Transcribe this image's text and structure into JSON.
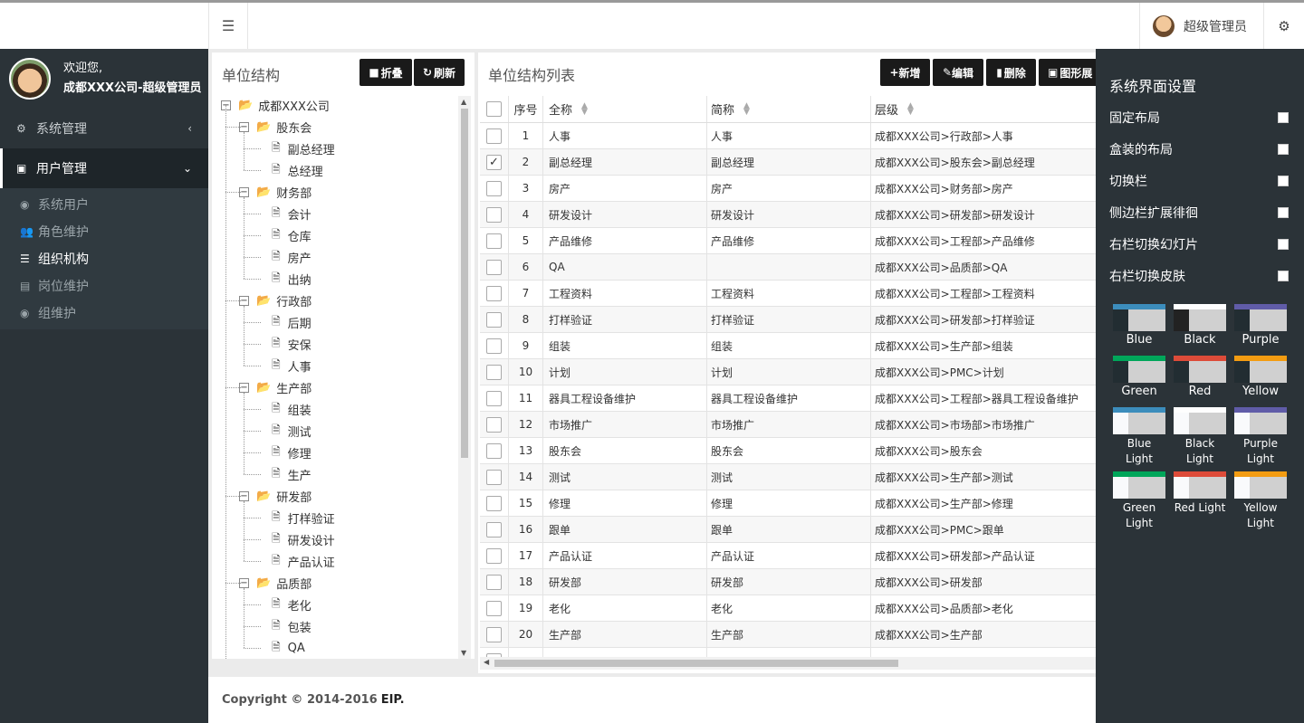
{
  "header": {
    "user_name": "超级管理员"
  },
  "sidebar": {
    "welcome": "欢迎您,",
    "company_user": "成都XXX公司-超级管理员",
    "menu": [
      {
        "label": "系统管理",
        "icon": "gear-icon"
      },
      {
        "label": "用户管理",
        "icon": "id-card-icon"
      }
    ],
    "submenu": [
      {
        "label": "系统用户",
        "icon": "user-circle-icon"
      },
      {
        "label": "角色维护",
        "icon": "users-icon"
      },
      {
        "label": "组织机构",
        "icon": "bars-icon"
      },
      {
        "label": "岗位维护",
        "icon": "id-badge-icon"
      },
      {
        "label": "组维护",
        "icon": "user-circle-icon"
      }
    ]
  },
  "tree_panel": {
    "title": "单位结构",
    "btn_collapse": "折叠",
    "btn_refresh": "刷新",
    "nodes": [
      {
        "label": "成都XXX公司",
        "level": 0,
        "type": "folder"
      },
      {
        "label": "股东会",
        "level": 1,
        "type": "folder"
      },
      {
        "label": "副总经理",
        "level": 2,
        "type": "doc"
      },
      {
        "label": "总经理",
        "level": 2,
        "type": "doc"
      },
      {
        "label": "财务部",
        "level": 1,
        "type": "folder"
      },
      {
        "label": "会计",
        "level": 2,
        "type": "doc"
      },
      {
        "label": "仓库",
        "level": 2,
        "type": "doc"
      },
      {
        "label": "房产",
        "level": 2,
        "type": "doc"
      },
      {
        "label": "出纳",
        "level": 2,
        "type": "doc"
      },
      {
        "label": "行政部",
        "level": 1,
        "type": "folder"
      },
      {
        "label": "后期",
        "level": 2,
        "type": "doc"
      },
      {
        "label": "安保",
        "level": 2,
        "type": "doc"
      },
      {
        "label": "人事",
        "level": 2,
        "type": "doc"
      },
      {
        "label": "生产部",
        "level": 1,
        "type": "folder"
      },
      {
        "label": "组装",
        "level": 2,
        "type": "doc"
      },
      {
        "label": "测试",
        "level": 2,
        "type": "doc"
      },
      {
        "label": "修理",
        "level": 2,
        "type": "doc"
      },
      {
        "label": "生产",
        "level": 2,
        "type": "doc"
      },
      {
        "label": "研发部",
        "level": 1,
        "type": "folder"
      },
      {
        "label": "打样验证",
        "level": 2,
        "type": "doc"
      },
      {
        "label": "研发设计",
        "level": 2,
        "type": "doc"
      },
      {
        "label": "产品认证",
        "level": 2,
        "type": "doc"
      },
      {
        "label": "品质部",
        "level": 1,
        "type": "folder"
      },
      {
        "label": "老化",
        "level": 2,
        "type": "doc"
      },
      {
        "label": "包装",
        "level": 2,
        "type": "doc"
      },
      {
        "label": "QA",
        "level": 2,
        "type": "doc"
      }
    ]
  },
  "list_panel": {
    "title": "单位结构列表",
    "btn_add": "新增",
    "btn_edit": "编辑",
    "btn_delete": "删除",
    "btn_graph": "图形展",
    "columns": {
      "no": "序号",
      "full": "全称",
      "short": "简称",
      "level": "层级"
    },
    "rows": [
      {
        "no": "1",
        "full": "人事",
        "short": "人事",
        "level": "成都XXX公司>行政部>人事",
        "checked": false
      },
      {
        "no": "2",
        "full": "副总经理",
        "short": "副总经理",
        "level": "成都XXX公司>股东会>副总经理",
        "checked": true
      },
      {
        "no": "3",
        "full": "房产",
        "short": "房产",
        "level": "成都XXX公司>财务部>房产",
        "checked": false
      },
      {
        "no": "4",
        "full": "研发设计",
        "short": "研发设计",
        "level": "成都XXX公司>研发部>研发设计",
        "checked": false
      },
      {
        "no": "5",
        "full": "产品维修",
        "short": "产品维修",
        "level": "成都XXX公司>工程部>产品维修",
        "checked": false
      },
      {
        "no": "6",
        "full": "QA",
        "short": "",
        "level": "成都XXX公司>品质部>QA",
        "checked": false
      },
      {
        "no": "7",
        "full": "工程资料",
        "short": "工程资料",
        "level": "成都XXX公司>工程部>工程资料",
        "checked": false
      },
      {
        "no": "8",
        "full": "打样验证",
        "short": "打样验证",
        "level": "成都XXX公司>研发部>打样验证",
        "checked": false
      },
      {
        "no": "9",
        "full": "组装",
        "short": "组装",
        "level": "成都XXX公司>生产部>组装",
        "checked": false
      },
      {
        "no": "10",
        "full": "计划",
        "short": "计划",
        "level": "成都XXX公司>PMC>计划",
        "checked": false
      },
      {
        "no": "11",
        "full": "器具工程设备维护",
        "short": "器具工程设备维护",
        "level": "成都XXX公司>工程部>器具工程设备维护",
        "checked": false
      },
      {
        "no": "12",
        "full": "市场推广",
        "short": "市场推广",
        "level": "成都XXX公司>市场部>市场推广",
        "checked": false
      },
      {
        "no": "13",
        "full": "股东会",
        "short": "股东会",
        "level": "成都XXX公司>股东会",
        "checked": false
      },
      {
        "no": "14",
        "full": "测试",
        "short": "测试",
        "level": "成都XXX公司>生产部>测试",
        "checked": false
      },
      {
        "no": "15",
        "full": "修理",
        "short": "修理",
        "level": "成都XXX公司>生产部>修理",
        "checked": false
      },
      {
        "no": "16",
        "full": "跟单",
        "short": "跟单",
        "level": "成都XXX公司>PMC>跟单",
        "checked": false
      },
      {
        "no": "17",
        "full": "产品认证",
        "short": "产品认证",
        "level": "成都XXX公司>研发部>产品认证",
        "checked": false
      },
      {
        "no": "18",
        "full": "研发部",
        "short": "研发部",
        "level": "成都XXX公司>研发部",
        "checked": false
      },
      {
        "no": "19",
        "full": "老化",
        "short": "老化",
        "level": "成都XXX公司>品质部>老化",
        "checked": false
      },
      {
        "no": "20",
        "full": "生产部",
        "short": "生产部",
        "level": "成都XXX公司>生产部",
        "checked": false
      }
    ]
  },
  "footer": {
    "copyright": "Copyright © 2014-2016",
    "brand": "EIP."
  },
  "settings_panel": {
    "title": "系统界面设置",
    "options": [
      "固定布局",
      "盒装的布局",
      "切换栏",
      "侧边栏扩展徘徊",
      "右栏切换幻灯片",
      "右栏切换皮肤"
    ],
    "skins": [
      {
        "name": "Blue",
        "top": "#3c8dbc",
        "side": "#222d32"
      },
      {
        "name": "Black",
        "top": "#fefefe",
        "side": "#222"
      },
      {
        "name": "Purple",
        "top": "#605ca8",
        "side": "#222d32"
      },
      {
        "name": "Green",
        "top": "#00a65a",
        "side": "#222d32"
      },
      {
        "name": "Red",
        "top": "#dd4b39",
        "side": "#222d32"
      },
      {
        "name": "Yellow",
        "top": "#f39c12",
        "side": "#222d32"
      },
      {
        "name": "Blue Light",
        "top": "#3c8dbc",
        "side": "#f9fafc"
      },
      {
        "name": "Black Light",
        "top": "#fefefe",
        "side": "#f9fafc"
      },
      {
        "name": "Purple Light",
        "top": "#605ca8",
        "side": "#f9fafc"
      },
      {
        "name": "Green Light",
        "top": "#00a65a",
        "side": "#f9fafc"
      },
      {
        "name": "Red Light",
        "top": "#dd4b39",
        "side": "#f9fafc"
      },
      {
        "name": "Yellow Light",
        "top": "#f39c12",
        "side": "#f9fafc"
      }
    ]
  }
}
